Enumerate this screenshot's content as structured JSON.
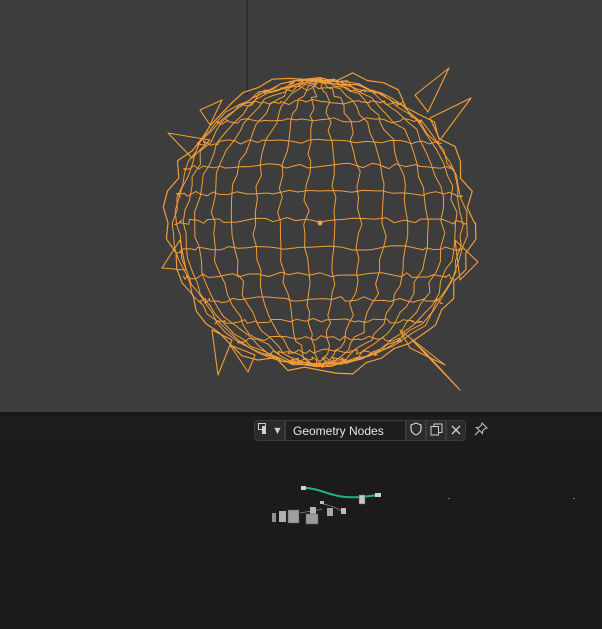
{
  "viewport": {
    "object_color": "#f29d38",
    "background_color": "#3d3d3d"
  },
  "node_editor_header": {
    "tree_type_icon": "node-tree-icon",
    "tree_name": "Geometry Nodes",
    "fake_user_icon": "shield-icon",
    "duplicate_icon": "duplicate-icon",
    "unlink_icon": "close-icon",
    "pin_icon": "pin-icon"
  },
  "node_editor": {
    "link_color": "#1fb58a",
    "background_color": "#1b1b1b"
  }
}
